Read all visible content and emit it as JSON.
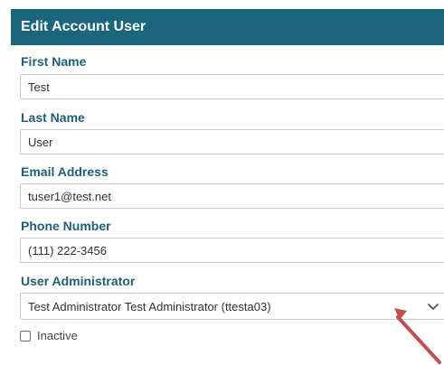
{
  "dialog": {
    "title": "Edit Account User"
  },
  "form": {
    "first_name": {
      "label": "First Name",
      "value": "Test"
    },
    "last_name": {
      "label": "Last Name",
      "value": "User"
    },
    "email": {
      "label": "Email Address",
      "value": "tuser1@test.net"
    },
    "phone": {
      "label": "Phone Number",
      "value": "(111) 222-3456"
    },
    "user_administrator": {
      "label": "User Administrator",
      "selected": "Test Administrator Test Administrator (ttesta03)"
    },
    "inactive": {
      "label": "Inactive",
      "checked": false
    }
  },
  "colors": {
    "header_bg": "#19667d",
    "label_color": "#1f5f78",
    "arrow_color": "#c0504d"
  },
  "icons": {
    "dropdown": "chevron-down-icon",
    "callout": "red-arrow"
  }
}
